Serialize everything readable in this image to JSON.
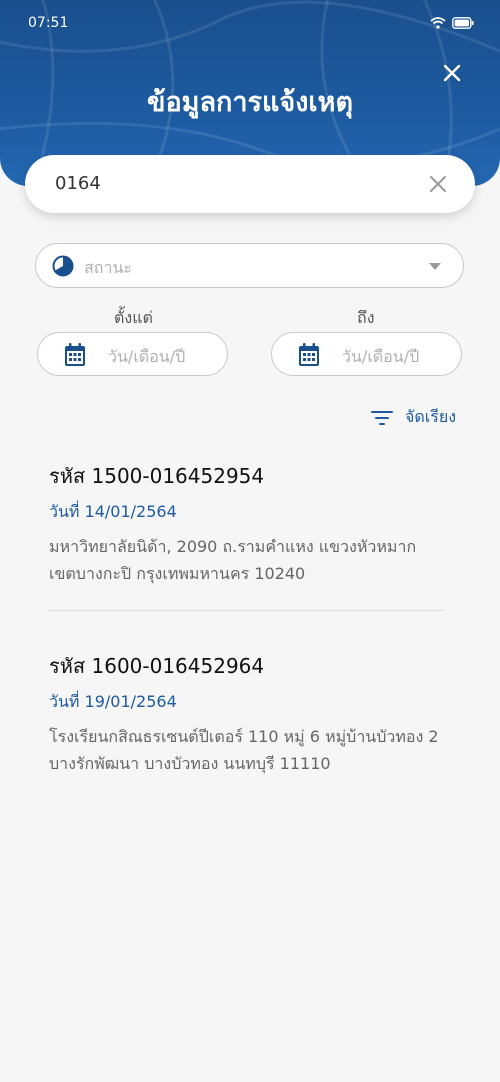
{
  "status_bar": {
    "time": "07:51"
  },
  "header": {
    "title": "ข้อมูลการแจ้งเหตุ"
  },
  "search": {
    "value": "0164"
  },
  "filters": {
    "status_placeholder": "สถานะ",
    "from_label": "ตั้งแต่",
    "to_label": "ถึง",
    "date_placeholder_from": "วัน/เดือน/ปี",
    "date_placeholder_to": "วัน/เดือน/ปี",
    "sort_label": "จัดเรียง"
  },
  "reports": [
    {
      "code": "รหัส 1500-016452954",
      "date": "วันที่ 14/01/2564",
      "address_line1": "มหาวิทยาลัยนิด้า, 2090 ถ.รามคำแหง แขวงหัวหมาก",
      "address_line2": "เขตบางกะปิ กรุงเทพมหานคร 10240"
    },
    {
      "code": "รหัส 1600-016452964",
      "date": "วันที่ 19/01/2564",
      "address_line1": "โรงเรียนกสิณธรเซนต์ปีเตอร์ 110 หมู่ 6  หมู่บ้านบัวทอง 2",
      "address_line2": "บางรักพัฒนา บางบัวทอง นนทบุรี 11110"
    }
  ],
  "colors": {
    "primary": "#1d5aa0",
    "header_dark": "#1a4f8d",
    "background": "#f6f6f6"
  }
}
